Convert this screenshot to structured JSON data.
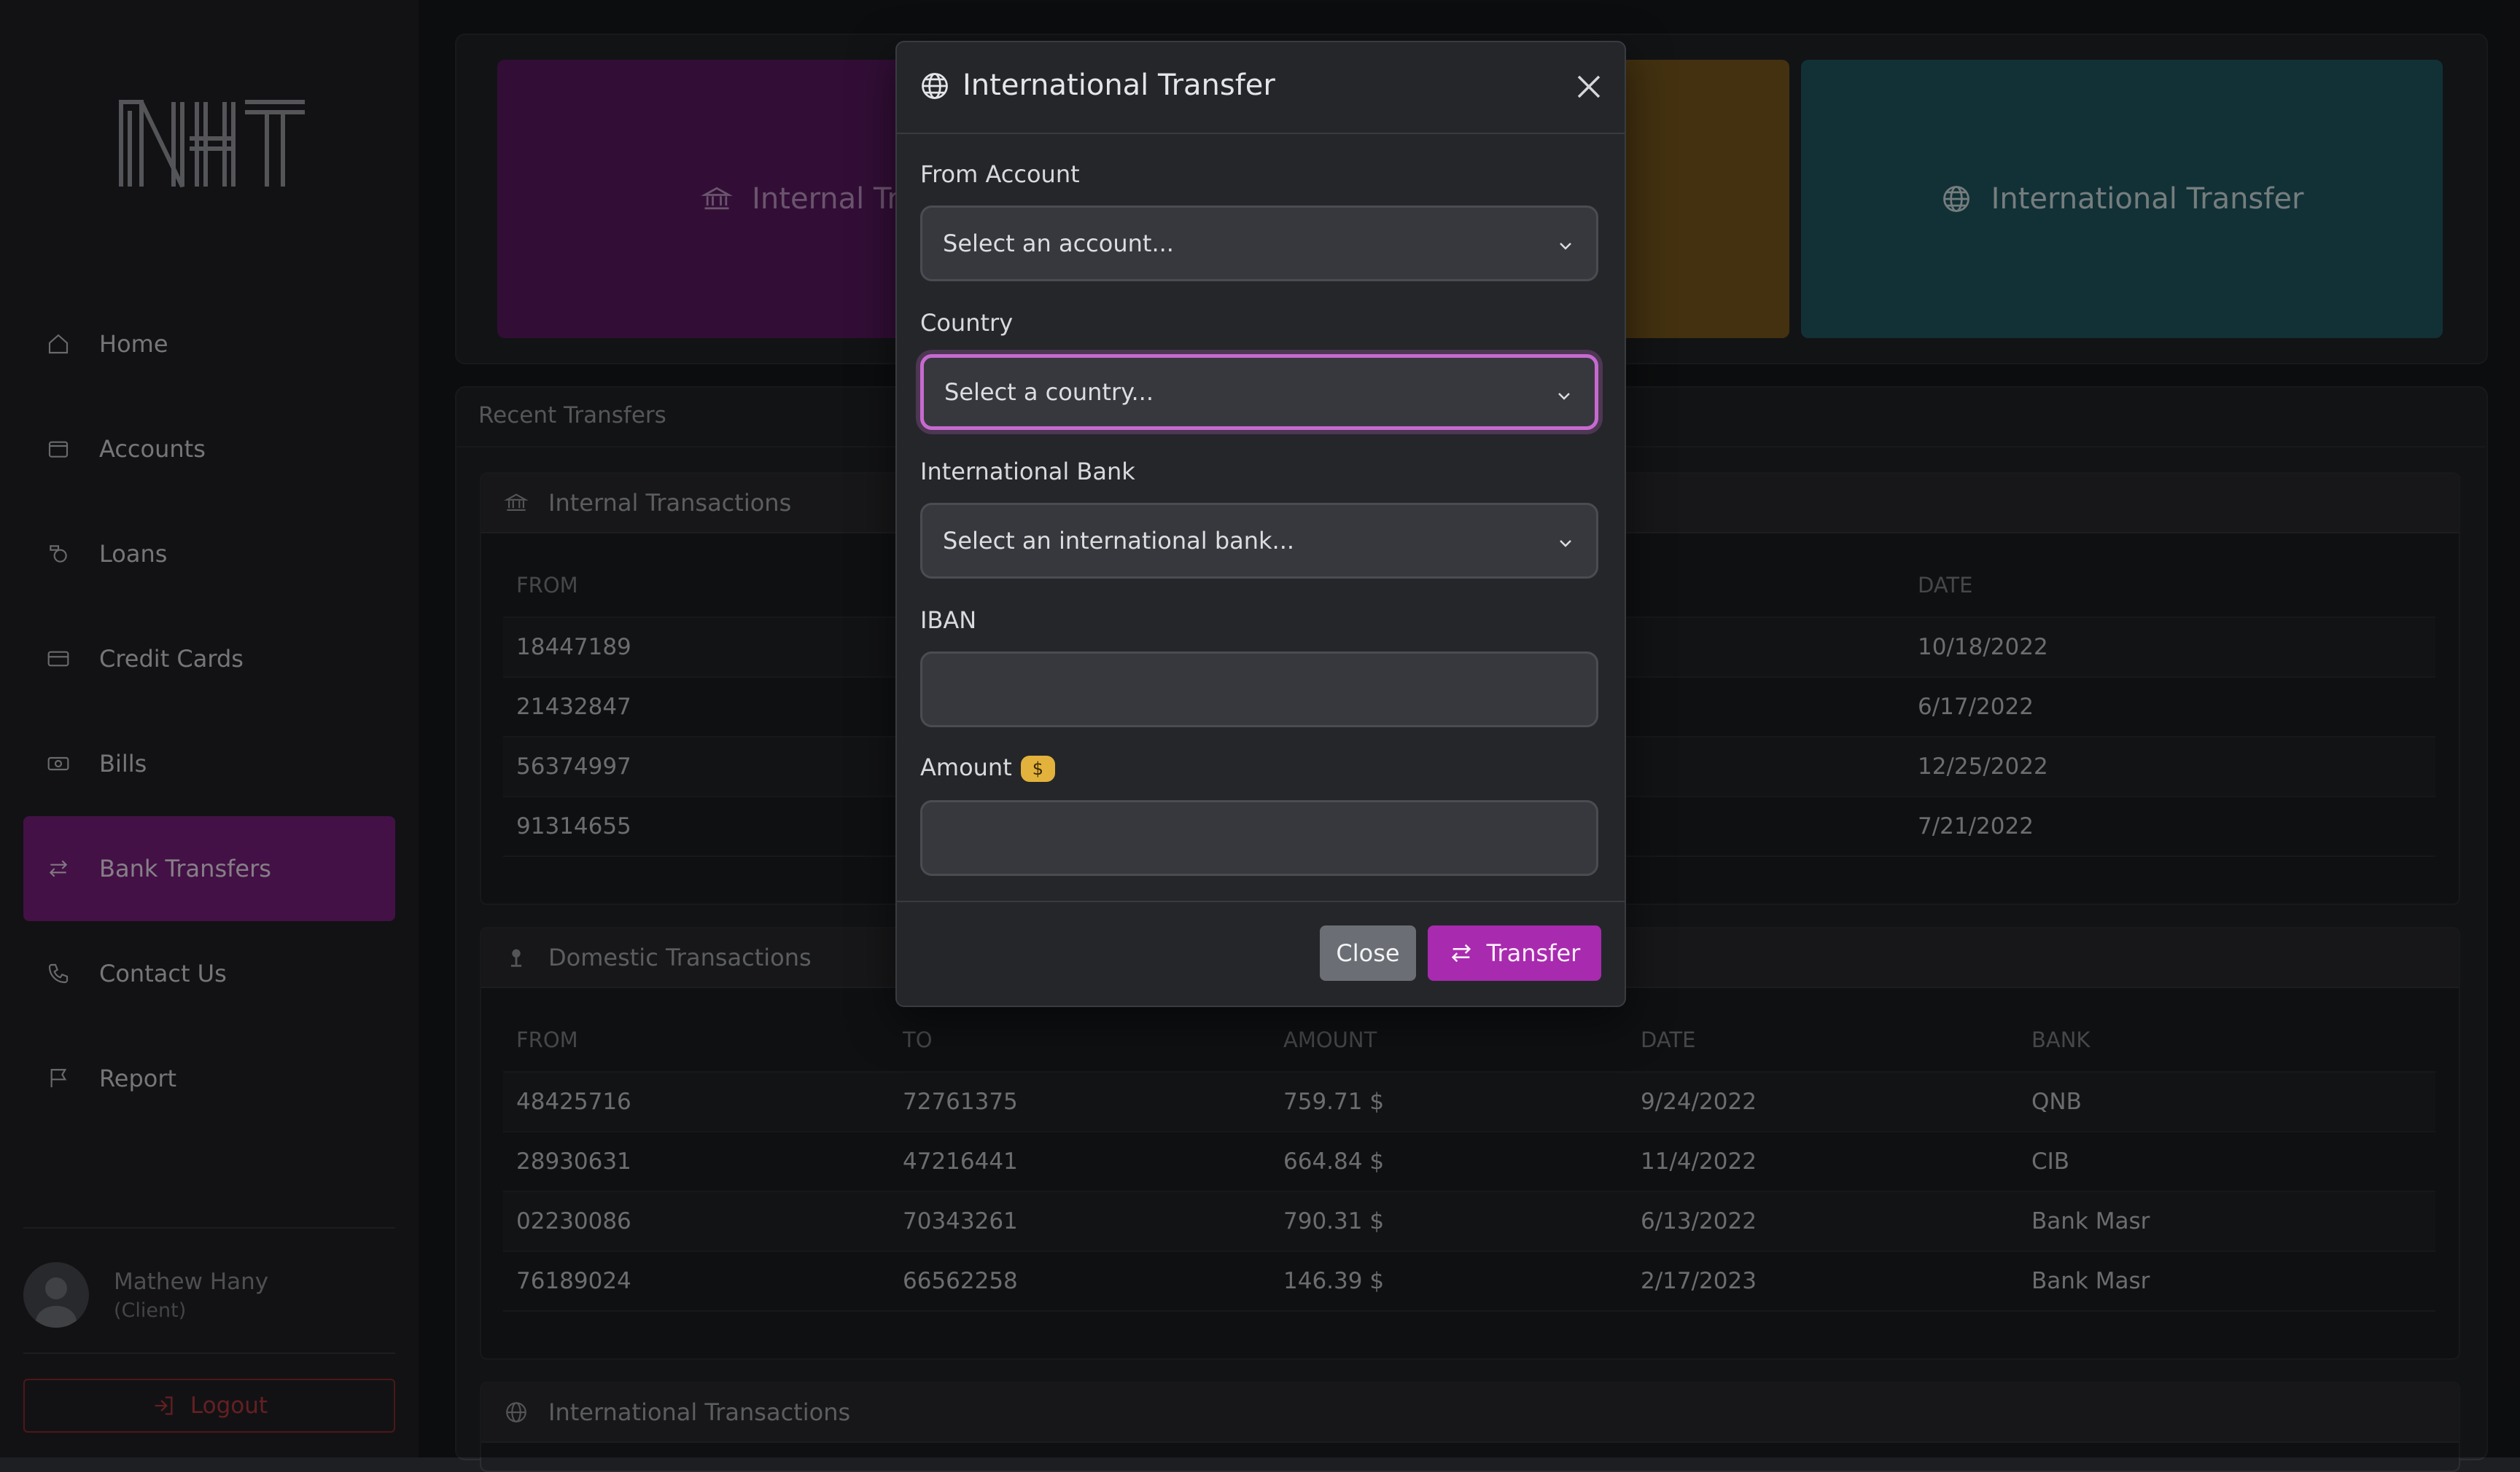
{
  "sidebar": {
    "logo_text": "NT",
    "items": [
      {
        "label": "Home",
        "icon": "home-icon"
      },
      {
        "label": "Accounts",
        "icon": "wallet-icon"
      },
      {
        "label": "Loans",
        "icon": "coins-icon"
      },
      {
        "label": "Credit Cards",
        "icon": "credit-card-icon"
      },
      {
        "label": "Bills",
        "icon": "cash-icon"
      },
      {
        "label": "Bank Transfers",
        "icon": "transfer-icon",
        "active": true
      },
      {
        "label": "Contact Us",
        "icon": "phone-icon"
      },
      {
        "label": "Report",
        "icon": "flag-icon"
      }
    ],
    "user": {
      "name": "Mathew Hany",
      "role": "(Client)"
    },
    "logout_label": "Logout"
  },
  "cards": [
    {
      "label": "Internal Tran",
      "icon": "bank-icon",
      "color": "#5c1a63"
    },
    {
      "label": "",
      "icon": "",
      "color": "#7a5a1e"
    },
    {
      "label": "International Transfer",
      "icon": "globe-icon",
      "color": "#1f5a63"
    }
  ],
  "recent_transfers_title": "Recent Transfers",
  "internal": {
    "title": "Internal Transactions",
    "headers": [
      "FROM",
      "DATE"
    ],
    "rows": [
      {
        "from": "18447189",
        "date": "10/18/2022"
      },
      {
        "from": "21432847",
        "date": "6/17/2022"
      },
      {
        "from": "56374997",
        "date": "12/25/2022"
      },
      {
        "from": "91314655",
        "date": "7/21/2022"
      }
    ]
  },
  "domestic": {
    "title": "Domestic Transactions",
    "headers": [
      "FROM",
      "TO",
      "AMOUNT",
      "DATE",
      "BANK"
    ],
    "rows": [
      {
        "from": "48425716",
        "to": "72761375",
        "amount": "759.71 $",
        "date": "9/24/2022",
        "bank": "QNB"
      },
      {
        "from": "28930631",
        "to": "47216441",
        "amount": "664.84 $",
        "date": "11/4/2022",
        "bank": "CIB"
      },
      {
        "from": "02230086",
        "to": "70343261",
        "amount": "790.31 $",
        "date": "6/13/2022",
        "bank": "Bank Masr"
      },
      {
        "from": "76189024",
        "to": "66562258",
        "amount": "146.39 $",
        "date": "2/17/2023",
        "bank": "Bank Masr"
      }
    ]
  },
  "international": {
    "title": "International Transactions"
  },
  "modal": {
    "title": "International Transfer",
    "from_account_label": "From Account",
    "from_account_value": "Select an account...",
    "country_label": "Country",
    "country_value": "Select a country...",
    "bank_label": "International Bank",
    "bank_value": "Select an international bank...",
    "iban_label": "IBAN",
    "iban_value": "",
    "amount_label": "Amount",
    "amount_badge": "$",
    "amount_value": "",
    "close_label": "Close",
    "transfer_label": "Transfer"
  },
  "colors": {
    "accent": "#a82aae",
    "active_nav": "#7a1f80",
    "danger": "#b83a40",
    "badge": "#e3b23c"
  }
}
